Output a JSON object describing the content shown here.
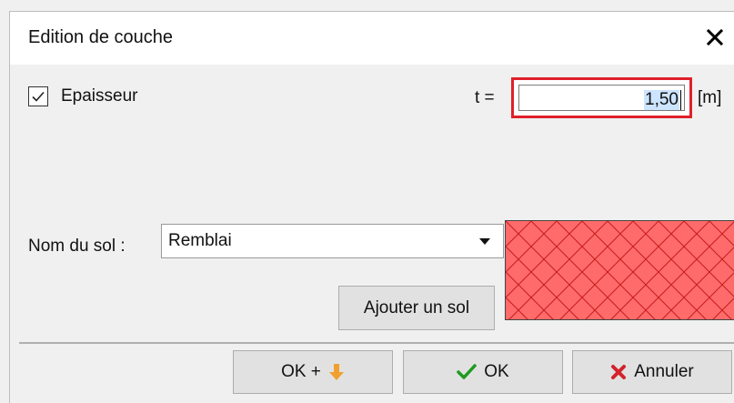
{
  "window": {
    "title": "Edition de couche",
    "close_icon": "close-icon"
  },
  "thickness": {
    "checkbox_label": "Epaisseur",
    "checked": true,
    "variable_label": "t =",
    "value": "1,50",
    "unit": "[m]"
  },
  "soil": {
    "label": "Nom du sol :",
    "selected": "Remblai",
    "swatch_color": "#ff6b6b",
    "swatch_pattern": "crosshatch",
    "add_button_label": "Ajouter un sol"
  },
  "buttons": {
    "ok_plus_label": "OK +",
    "ok_plus_icon": "arrow-down-icon",
    "ok_label": "OK",
    "ok_icon": "checkmark-icon",
    "cancel_label": "Annuler",
    "cancel_icon": "x-icon"
  },
  "colors": {
    "focus_border": "#e0202a",
    "ok_check": "#1e9a1e",
    "cancel_x": "#d4232b",
    "arrow": "#f0a030"
  }
}
